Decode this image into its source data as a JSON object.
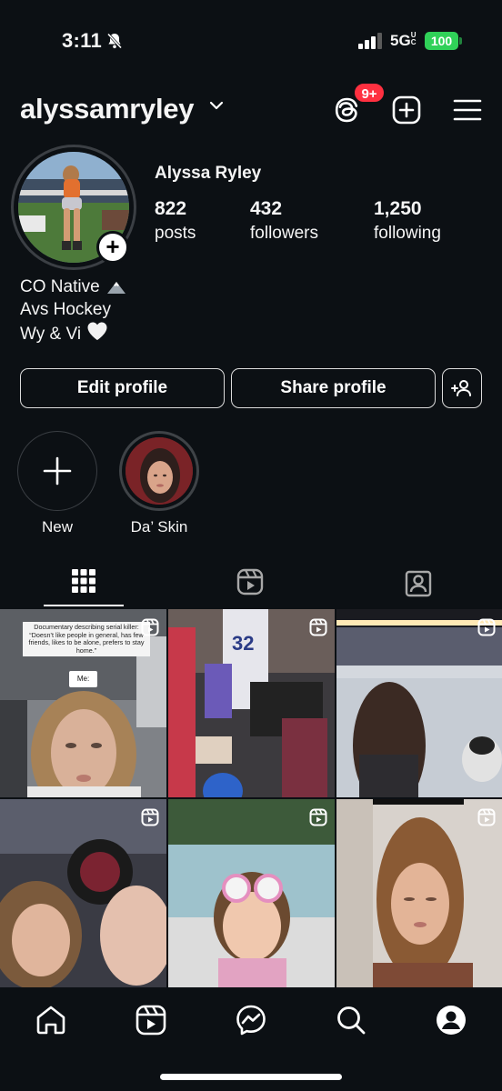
{
  "status_bar": {
    "time": "3:11",
    "network": "5G",
    "network_suffix": "UC",
    "battery": "100",
    "battery_color": "#30d158",
    "icons": [
      "bell-slash-icon",
      "signal-icon"
    ]
  },
  "header": {
    "username": "alyssamryley",
    "threads_badge": "9+",
    "badge_color": "#ff3040",
    "icons": [
      "chevron-down-icon",
      "threads-icon",
      "add-post-icon",
      "menu-icon"
    ]
  },
  "profile": {
    "display_name": "Alyssa Ryley",
    "stats": [
      {
        "value": "822",
        "label": "posts"
      },
      {
        "value": "432",
        "label": "followers"
      },
      {
        "value": "1,250",
        "label": "following"
      }
    ],
    "bio": [
      "CO Native",
      "Avs Hockey",
      "Wy & Vi"
    ],
    "bio_icons": [
      "mountain-icon",
      "white-heart-icon"
    ]
  },
  "actions": {
    "edit_profile": "Edit profile",
    "share_profile": "Share profile",
    "discover_icon": "add-person-icon"
  },
  "highlights": [
    {
      "label": "New",
      "icon": "plus-icon"
    },
    {
      "label": "Da’ Skin"
    }
  ],
  "tabs": [
    {
      "name": "posts",
      "icon": "grid-icon",
      "active": true
    },
    {
      "name": "reels",
      "icon": "reels-icon",
      "active": false
    },
    {
      "name": "tagged",
      "icon": "tagged-icon",
      "active": false
    }
  ],
  "grid": {
    "post1_caption": "Documentary describing serial killer: “Doesn’t like people in general, has few friends, likes to be alone, prefers to stay home.”",
    "post1_me": "Me:",
    "items": [
      {
        "type": "reel",
        "icon": "reel-icon"
      },
      {
        "type": "reel",
        "icon": "reel-icon"
      },
      {
        "type": "reel",
        "icon": "reel-icon"
      },
      {
        "type": "reel",
        "icon": "reel-icon"
      },
      {
        "type": "reel",
        "icon": "reel-icon"
      },
      {
        "type": "reel",
        "icon": "reel-icon"
      }
    ]
  },
  "bottom_nav": [
    "home-icon",
    "reels-icon",
    "messenger-icon",
    "search-icon",
    "profile-icon"
  ]
}
